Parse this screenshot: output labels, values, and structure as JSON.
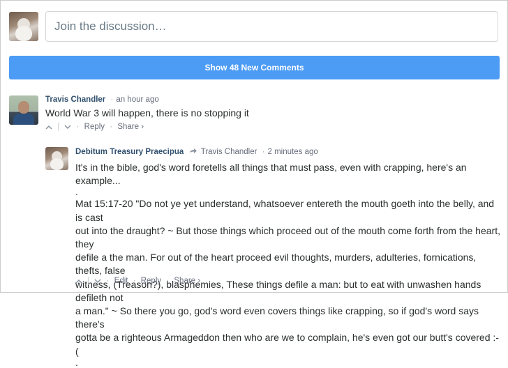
{
  "composer": {
    "placeholder": "Join the discussion…"
  },
  "new_comments": {
    "label": "Show 48 New Comments"
  },
  "comments": [
    {
      "author": "Travis Chandler",
      "time": "an hour ago",
      "body_lines": [
        "World War 3 will happen, there is no stopping it"
      ],
      "actions": {
        "upvote_icon": "chevron-up-icon",
        "downvote_icon": "chevron-down-icon",
        "reply": "Reply",
        "share": "Share ›"
      }
    },
    {
      "author": "Debitum Treasury Praecipua",
      "reply_to": "Travis Chandler",
      "time": "2 minutes ago",
      "body_lines": [
        "It's in the bible, god's word foretells all things that must pass, even with crapping, here's an example...",
        ".",
        "Mat 15:17-20 \"Do not ye yet understand, whatsoever entereth the mouth goeth into the belly, and is cast",
        "out into the draught? ~ But those things which proceed out of the mouth come forth from the heart, they",
        "defile a the man. For out of the heart proceed evil thoughts, murders, adulteries, fornications, thefts, false",
        "witness, (Treason?), blasphemies, These things defile a man: but to eat with unwashen hands defileth not",
        "a man.\" ~ So there you go, god's word even covers things like crapping, so if god's word says there's",
        "gotta be a righteous Armageddon then who are we to complain, he's even got our butt's covered :-(",
        "."
      ],
      "actions": {
        "upvote_icon": "chevron-up-icon",
        "downvote_icon": "chevron-down-icon",
        "edit": "Edit",
        "reply": "Reply",
        "share": "Share ›"
      }
    }
  ]
}
